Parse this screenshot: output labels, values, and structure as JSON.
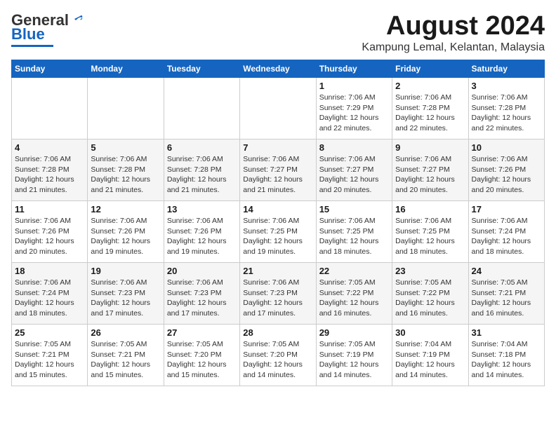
{
  "logo": {
    "general": "General",
    "blue": "Blue"
  },
  "header": {
    "month_year": "August 2024",
    "location": "Kampung Lemal, Kelantan, Malaysia"
  },
  "weekdays": [
    "Sunday",
    "Monday",
    "Tuesday",
    "Wednesday",
    "Thursday",
    "Friday",
    "Saturday"
  ],
  "weeks": [
    [
      {
        "day": "",
        "detail": ""
      },
      {
        "day": "",
        "detail": ""
      },
      {
        "day": "",
        "detail": ""
      },
      {
        "day": "",
        "detail": ""
      },
      {
        "day": "1",
        "detail": "Sunrise: 7:06 AM\nSunset: 7:29 PM\nDaylight: 12 hours\nand 22 minutes."
      },
      {
        "day": "2",
        "detail": "Sunrise: 7:06 AM\nSunset: 7:28 PM\nDaylight: 12 hours\nand 22 minutes."
      },
      {
        "day": "3",
        "detail": "Sunrise: 7:06 AM\nSunset: 7:28 PM\nDaylight: 12 hours\nand 22 minutes."
      }
    ],
    [
      {
        "day": "4",
        "detail": "Sunrise: 7:06 AM\nSunset: 7:28 PM\nDaylight: 12 hours\nand 21 minutes."
      },
      {
        "day": "5",
        "detail": "Sunrise: 7:06 AM\nSunset: 7:28 PM\nDaylight: 12 hours\nand 21 minutes."
      },
      {
        "day": "6",
        "detail": "Sunrise: 7:06 AM\nSunset: 7:28 PM\nDaylight: 12 hours\nand 21 minutes."
      },
      {
        "day": "7",
        "detail": "Sunrise: 7:06 AM\nSunset: 7:27 PM\nDaylight: 12 hours\nand 21 minutes."
      },
      {
        "day": "8",
        "detail": "Sunrise: 7:06 AM\nSunset: 7:27 PM\nDaylight: 12 hours\nand 20 minutes."
      },
      {
        "day": "9",
        "detail": "Sunrise: 7:06 AM\nSunset: 7:27 PM\nDaylight: 12 hours\nand 20 minutes."
      },
      {
        "day": "10",
        "detail": "Sunrise: 7:06 AM\nSunset: 7:26 PM\nDaylight: 12 hours\nand 20 minutes."
      }
    ],
    [
      {
        "day": "11",
        "detail": "Sunrise: 7:06 AM\nSunset: 7:26 PM\nDaylight: 12 hours\nand 20 minutes."
      },
      {
        "day": "12",
        "detail": "Sunrise: 7:06 AM\nSunset: 7:26 PM\nDaylight: 12 hours\nand 19 minutes."
      },
      {
        "day": "13",
        "detail": "Sunrise: 7:06 AM\nSunset: 7:26 PM\nDaylight: 12 hours\nand 19 minutes."
      },
      {
        "day": "14",
        "detail": "Sunrise: 7:06 AM\nSunset: 7:25 PM\nDaylight: 12 hours\nand 19 minutes."
      },
      {
        "day": "15",
        "detail": "Sunrise: 7:06 AM\nSunset: 7:25 PM\nDaylight: 12 hours\nand 18 minutes."
      },
      {
        "day": "16",
        "detail": "Sunrise: 7:06 AM\nSunset: 7:25 PM\nDaylight: 12 hours\nand 18 minutes."
      },
      {
        "day": "17",
        "detail": "Sunrise: 7:06 AM\nSunset: 7:24 PM\nDaylight: 12 hours\nand 18 minutes."
      }
    ],
    [
      {
        "day": "18",
        "detail": "Sunrise: 7:06 AM\nSunset: 7:24 PM\nDaylight: 12 hours\nand 18 minutes."
      },
      {
        "day": "19",
        "detail": "Sunrise: 7:06 AM\nSunset: 7:23 PM\nDaylight: 12 hours\nand 17 minutes."
      },
      {
        "day": "20",
        "detail": "Sunrise: 7:06 AM\nSunset: 7:23 PM\nDaylight: 12 hours\nand 17 minutes."
      },
      {
        "day": "21",
        "detail": "Sunrise: 7:06 AM\nSunset: 7:23 PM\nDaylight: 12 hours\nand 17 minutes."
      },
      {
        "day": "22",
        "detail": "Sunrise: 7:05 AM\nSunset: 7:22 PM\nDaylight: 12 hours\nand 16 minutes."
      },
      {
        "day": "23",
        "detail": "Sunrise: 7:05 AM\nSunset: 7:22 PM\nDaylight: 12 hours\nand 16 minutes."
      },
      {
        "day": "24",
        "detail": "Sunrise: 7:05 AM\nSunset: 7:21 PM\nDaylight: 12 hours\nand 16 minutes."
      }
    ],
    [
      {
        "day": "25",
        "detail": "Sunrise: 7:05 AM\nSunset: 7:21 PM\nDaylight: 12 hours\nand 15 minutes."
      },
      {
        "day": "26",
        "detail": "Sunrise: 7:05 AM\nSunset: 7:21 PM\nDaylight: 12 hours\nand 15 minutes."
      },
      {
        "day": "27",
        "detail": "Sunrise: 7:05 AM\nSunset: 7:20 PM\nDaylight: 12 hours\nand 15 minutes."
      },
      {
        "day": "28",
        "detail": "Sunrise: 7:05 AM\nSunset: 7:20 PM\nDaylight: 12 hours\nand 14 minutes."
      },
      {
        "day": "29",
        "detail": "Sunrise: 7:05 AM\nSunset: 7:19 PM\nDaylight: 12 hours\nand 14 minutes."
      },
      {
        "day": "30",
        "detail": "Sunrise: 7:04 AM\nSunset: 7:19 PM\nDaylight: 12 hours\nand 14 minutes."
      },
      {
        "day": "31",
        "detail": "Sunrise: 7:04 AM\nSunset: 7:18 PM\nDaylight: 12 hours\nand 14 minutes."
      }
    ]
  ]
}
